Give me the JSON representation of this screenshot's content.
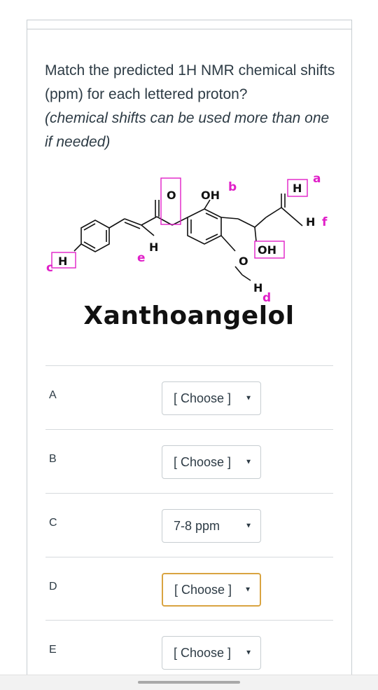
{
  "question": {
    "text": "Match the predicted 1H NMR chemical shifts (ppm) for each lettered proton?",
    "note": "(chemical shifts can be used more than one if needed)"
  },
  "molecule": {
    "name": "Xanthoangelol",
    "labels": {
      "O_top": "O",
      "OH_top": "OH",
      "b": "b",
      "H_a": "H",
      "a": "a",
      "H_f": "H",
      "f": "f",
      "H_e": "H",
      "e": "e",
      "H_c": "H",
      "c": "c",
      "OH_box": "OH",
      "O_ring": "O",
      "H_d": "H",
      "d": "d"
    },
    "colors": {
      "highlight": "#e020c8",
      "bond": "#111111"
    }
  },
  "rows": [
    {
      "label": "A",
      "value": "[ Choose ]",
      "focused": false
    },
    {
      "label": "B",
      "value": "[ Choose ]",
      "focused": false
    },
    {
      "label": "C",
      "value": "7-8 ppm",
      "focused": false
    },
    {
      "label": "D",
      "value": "[ Choose ]",
      "focused": true
    },
    {
      "label": "E",
      "value": "[ Choose ]",
      "focused": false
    }
  ],
  "caret_icon": "▼"
}
